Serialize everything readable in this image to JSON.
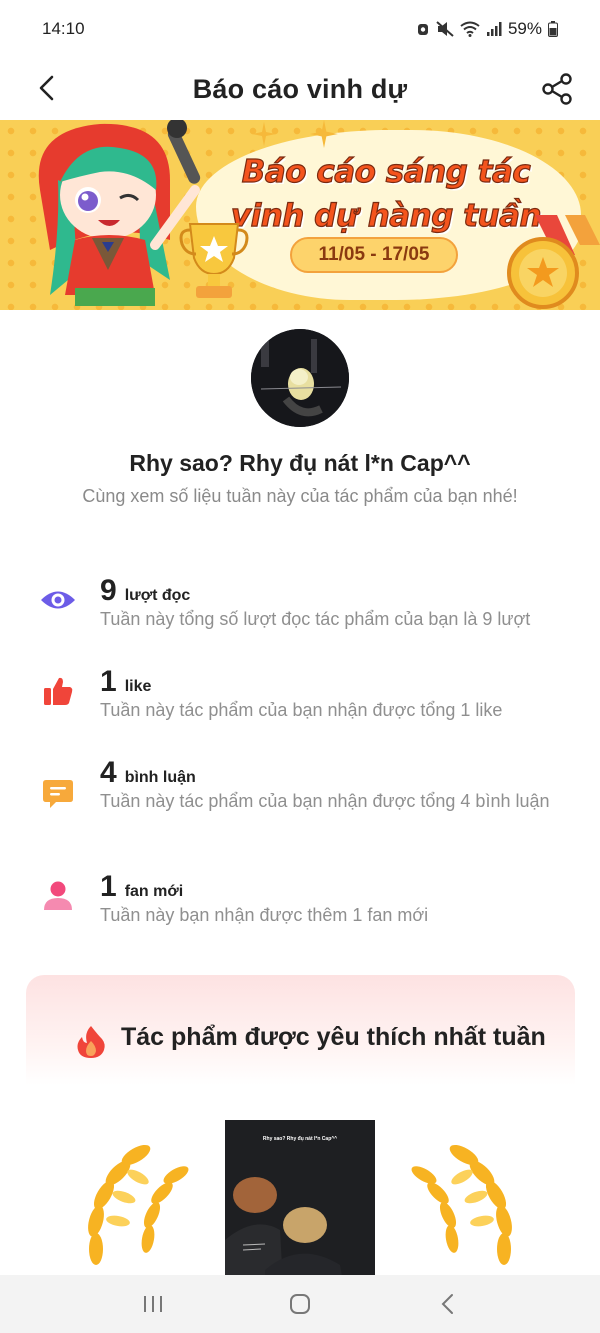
{
  "status_bar": {
    "time": "14:10",
    "battery": "59%"
  },
  "header": {
    "title": "Báo cáo vinh dự",
    "back_icon": "chevron-left-icon",
    "share_icon": "share-icon"
  },
  "banner": {
    "title_line1": "Báo cáo sáng tác",
    "title_line2": "vinh dự hàng tuần",
    "date_range": "11/05 - 17/05"
  },
  "work": {
    "title": "Rhy sao? Rhy đụ nát l*n Cap^^",
    "subtitle": "Cùng xem số liệu tuần này của tác phẩm của bạn nhé!"
  },
  "stats": [
    {
      "icon": "eye-icon",
      "color": "#6c5ce7",
      "value": "9",
      "unit": "lượt đọc",
      "description": "Tuần này tổng số lượt đọc tác phẩm của bạn là 9 lượt"
    },
    {
      "icon": "thumbs-up-icon",
      "color": "#f0453a",
      "value": "1",
      "unit": "like",
      "description": "Tuần này tác phẩm của bạn nhận được tổng 1 like"
    },
    {
      "icon": "comment-icon",
      "color": "#f7a93b",
      "value": "4",
      "unit": "bình luận",
      "description": "Tuần này tác phẩm của bạn nhận được tổng 4 bình luận"
    },
    {
      "icon": "user-icon",
      "color": "#f2497c",
      "value": "1",
      "unit": "fan mới",
      "description": "Tuần này bạn nhận được thêm 1 fan mới"
    }
  ],
  "favorite": {
    "title": "Tác phẩm được yêu thích nhất tuần",
    "cover_text": "Rhy sao? Rhy đụ nát l*n Cap^^"
  },
  "nav": {
    "recent_icon": "recent-apps-icon",
    "home_icon": "home-icon",
    "back_icon": "back-icon"
  }
}
